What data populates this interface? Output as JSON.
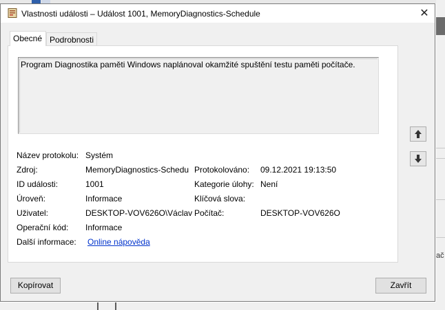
{
  "window": {
    "title": "Vlastnosti události – Událost 1001, MemoryDiagnostics-Schedule",
    "close_glyph": "✕"
  },
  "tabs": [
    {
      "label": "Obecné",
      "active": true
    },
    {
      "label": "Podrobnosti",
      "active": false
    }
  ],
  "description": "Program Diagnostika paměti Windows naplánoval okamžité spuštění testu paměti počítače.",
  "fields": {
    "log_name": {
      "label": "Název protokolu:",
      "value": "Systém"
    },
    "source": {
      "label": "Zdroj:",
      "value": "MemoryDiagnostics-Schedu"
    },
    "logged": {
      "label": "Protokolováno:",
      "value": "09.12.2021 19:13:50"
    },
    "event_id": {
      "label": "ID události:",
      "value": "1001"
    },
    "task_category": {
      "label": "Kategorie úlohy:",
      "value": "Není"
    },
    "level": {
      "label": "Úroveň:",
      "value": "Informace"
    },
    "keywords": {
      "label": "Klíčová slova:",
      "value": ""
    },
    "user": {
      "label": "Uživatel:",
      "value": "DESKTOP-VOV626O\\Václav"
    },
    "computer": {
      "label": "Počítač:",
      "value": "DESKTOP-VOV626O"
    },
    "opcode": {
      "label": "Operační kód:",
      "value": "Informace"
    },
    "more_info": {
      "label": "Další informace:",
      "link": "Online nápověda"
    }
  },
  "nav": {
    "up_icon": "arrow-up-icon",
    "down_icon": "arrow-down-icon"
  },
  "buttons": {
    "copy": "Kopírovat",
    "close": "Zavřít"
  },
  "background": {
    "partial_text": "ač"
  },
  "colors": {
    "link": "#0033cc",
    "dialog_bg": "#f0f0f0",
    "panel_bg": "#ffffff"
  }
}
